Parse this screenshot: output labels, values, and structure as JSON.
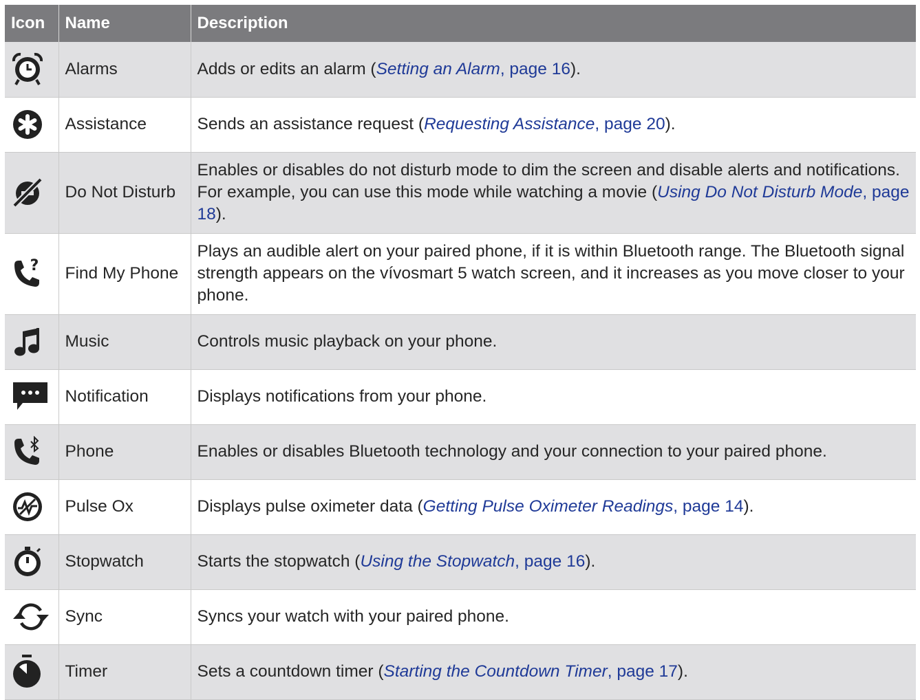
{
  "headers": {
    "icon": "Icon",
    "name": "Name",
    "description": "Description"
  },
  "rows": [
    {
      "icon": "alarm-clock-icon",
      "name": "Alarms",
      "pre": "Adds or edits an alarm (",
      "ref": "Setting an Alarm",
      "page": ", page 16",
      "post": ")."
    },
    {
      "icon": "assistance-icon",
      "name": "Assistance",
      "pre": "Sends an assistance request (",
      "ref": "Requesting Assistance",
      "page": ", page 20",
      "post": ")."
    },
    {
      "icon": "do-not-disturb-icon",
      "name": "Do Not Disturb",
      "pre": "Enables or disables do not disturb mode to dim the screen and disable alerts and notifications. For example, you can use this mode while watching a movie (",
      "ref": "Using Do Not Disturb Mode",
      "page": ", page 18",
      "post": ")."
    },
    {
      "icon": "find-my-phone-icon",
      "name": "Find My Phone",
      "pre": "Plays an audible alert on your paired phone, if it is within Bluetooth range. The Bluetooth signal strength appears on the vívosmart 5 watch screen, and it increases as you move closer to your phone."
    },
    {
      "icon": "music-note-icon",
      "name": "Music",
      "pre": "Controls music playback on your phone."
    },
    {
      "icon": "notification-icon",
      "name": "Notification",
      "pre": "Displays notifications from your phone."
    },
    {
      "icon": "phone-bluetooth-icon",
      "name": "Phone",
      "pre": "Enables or disables Bluetooth technology and your connection to your paired phone."
    },
    {
      "icon": "pulse-ox-icon",
      "name": "Pulse Ox",
      "pre": "Displays pulse oximeter data (",
      "ref": "Getting Pulse Oximeter Readings",
      "page": ", page 14",
      "post": ")."
    },
    {
      "icon": "stopwatch-icon",
      "name": "Stopwatch",
      "pre": "Starts the stopwatch (",
      "ref": "Using the Stopwatch",
      "page": ", page 16",
      "post": ")."
    },
    {
      "icon": "sync-icon",
      "name": "Sync",
      "pre": "Syncs your watch with your paired phone."
    },
    {
      "icon": "timer-icon",
      "name": "Timer",
      "pre": "Sets a countdown timer (",
      "ref": "Starting the Countdown Timer",
      "page": ", page 17",
      "post": ")."
    }
  ]
}
